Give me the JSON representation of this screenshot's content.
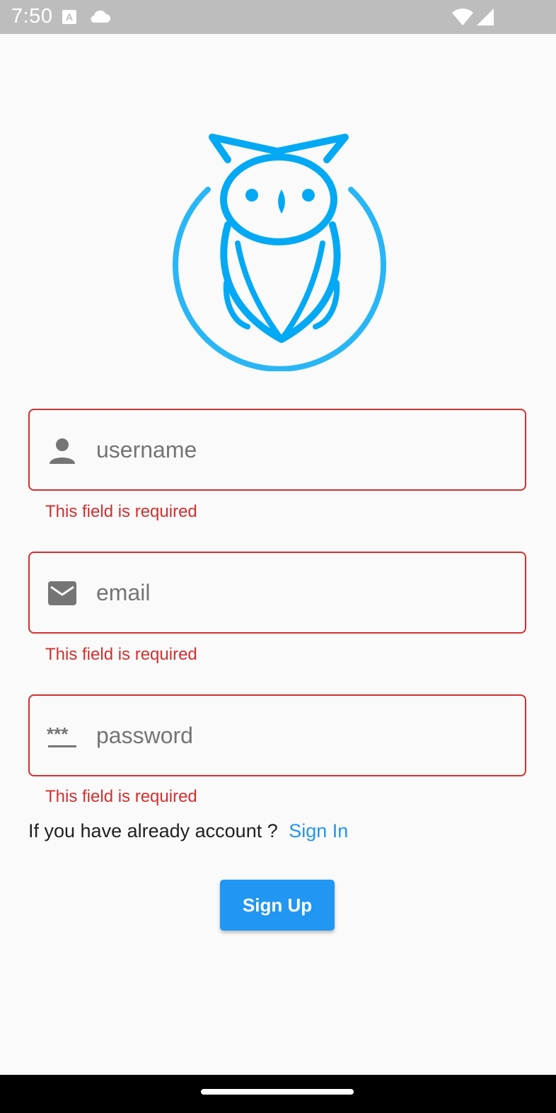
{
  "status_bar": {
    "time": "7:50",
    "notification_letter": "A",
    "icons": [
      "text-notification-icon",
      "cloud-icon",
      "wifi-icon",
      "signal-icon"
    ]
  },
  "logo": {
    "icon": "owl-logo",
    "color": "#03a9f4"
  },
  "form": {
    "username": {
      "placeholder": "username",
      "value": "",
      "icon": "person-icon",
      "error": "This field is required"
    },
    "email": {
      "placeholder": "email",
      "value": "",
      "icon": "mail-icon",
      "error": "This field is required"
    },
    "password": {
      "placeholder": "password",
      "value": "",
      "icon": "password-icon",
      "error": "This field is required"
    }
  },
  "signin": {
    "prompt": "If you have already account ?",
    "link_label": "Sign In"
  },
  "signup_button": {
    "label": "Sign Up"
  },
  "colors": {
    "accent": "#2196f3",
    "error": "#d32f2f",
    "logo": "#03a9f4",
    "status_bar": "#bdbdbd"
  }
}
